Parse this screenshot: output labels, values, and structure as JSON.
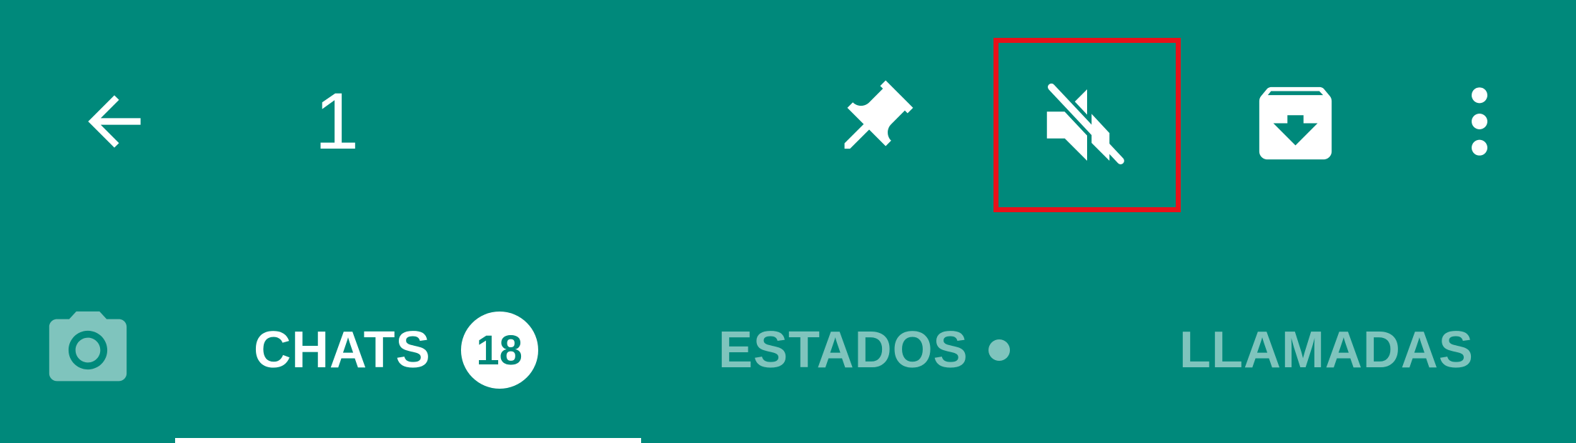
{
  "colors": {
    "toolbar_bg": "#00897B",
    "icon": "#FFFFFF",
    "inactive_tab": "#7FC4BD",
    "highlight_box": "#E8111A"
  },
  "toolbar": {
    "back_icon": "arrow-left-icon",
    "selected_count": "1",
    "actions": [
      {
        "icon": "pin-icon"
      },
      {
        "icon": "mute-icon",
        "highlighted": true
      },
      {
        "icon": "archive-icon"
      },
      {
        "icon": "more-vert-icon"
      }
    ]
  },
  "tabs": {
    "camera_icon": "camera-icon",
    "items": [
      {
        "label": "CHATS",
        "badge": "18",
        "active": true
      },
      {
        "label": "ESTADOS",
        "dot": true,
        "active": false
      },
      {
        "label": "LLAMADAS",
        "active": false
      }
    ]
  }
}
